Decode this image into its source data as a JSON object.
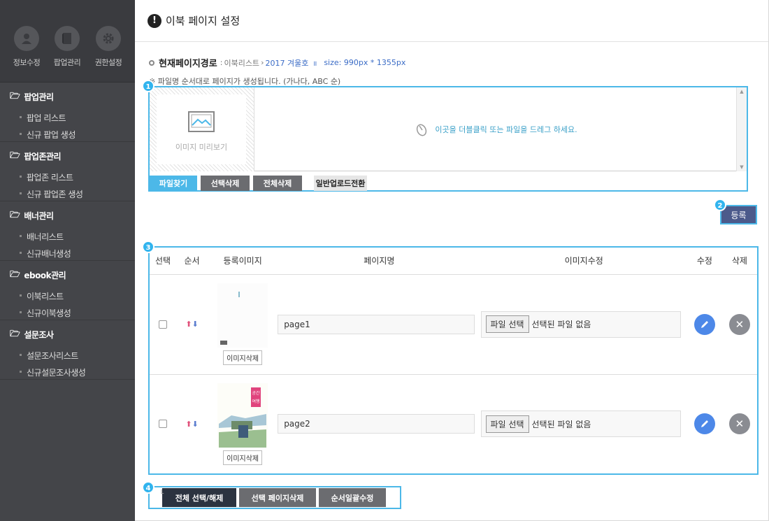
{
  "sidebar": {
    "top_icons": [
      {
        "label": "정보수정",
        "icon": "user-icon"
      },
      {
        "label": "팝업관리",
        "icon": "book-icon"
      },
      {
        "label": "권한설정",
        "icon": "gear-icon"
      }
    ],
    "sections": [
      {
        "title": "팝업관리",
        "items": [
          "팝업 리스트",
          "신규 팝업 생성"
        ]
      },
      {
        "title": "팝업존관리",
        "items": [
          "팝업존 리스트",
          "신규 팝업존 생성"
        ]
      },
      {
        "title": "배너관리",
        "items": [
          "배너리스트",
          "신규배너생성"
        ]
      },
      {
        "title": "ebook관리",
        "items": [
          "이북리스트",
          "신규이북생성"
        ]
      },
      {
        "title": "설문조사",
        "items": [
          "설문조사리스트",
          "신규설문조사생성"
        ]
      }
    ]
  },
  "header": {
    "title": "이북 페이지 설정"
  },
  "path": {
    "label": "현재페이지경로",
    "sep": ":",
    "crumb1": "이북리스트",
    "crumb2": "2017 겨울호",
    "size": "size: 990px * 1355px"
  },
  "note": "※ 파일명 순서대로 페이지가 생성됩니다. (가나다, ABC 순)",
  "upload": {
    "preview_label": "이미지 미리보기",
    "drop_text": "이곳을 더블클릭 또는 파일을 드레그 하세요.",
    "buttons": [
      "파일찾기",
      "선택삭제",
      "전체삭제",
      "일반업로드전환"
    ]
  },
  "register_label": "등록",
  "badges": [
    "1",
    "2",
    "3",
    "4"
  ],
  "table": {
    "headers": [
      "선택",
      "순서",
      "등록이미지",
      "페이지명",
      "이미지수정",
      "수정",
      "삭제"
    ],
    "rows": [
      {
        "page_name": "page1",
        "file_button": "파일 선택",
        "file_status": "선택된 파일 없음",
        "img_delete": "이미지삭제"
      },
      {
        "page_name": "page2",
        "file_button": "파일 선택",
        "file_status": "선택된 파일 없음",
        "img_delete": "이미지삭제",
        "thumb_text": "공간여행"
      }
    ]
  },
  "bottom": {
    "buttons": [
      "전체 선택/해제",
      "선택 페이지삭제",
      "순서일괄수정"
    ]
  },
  "colors": {
    "accent": "#4cb8e8",
    "sidebar": "#444549",
    "register": "#4c5a8b",
    "edit": "#4d88e8"
  }
}
